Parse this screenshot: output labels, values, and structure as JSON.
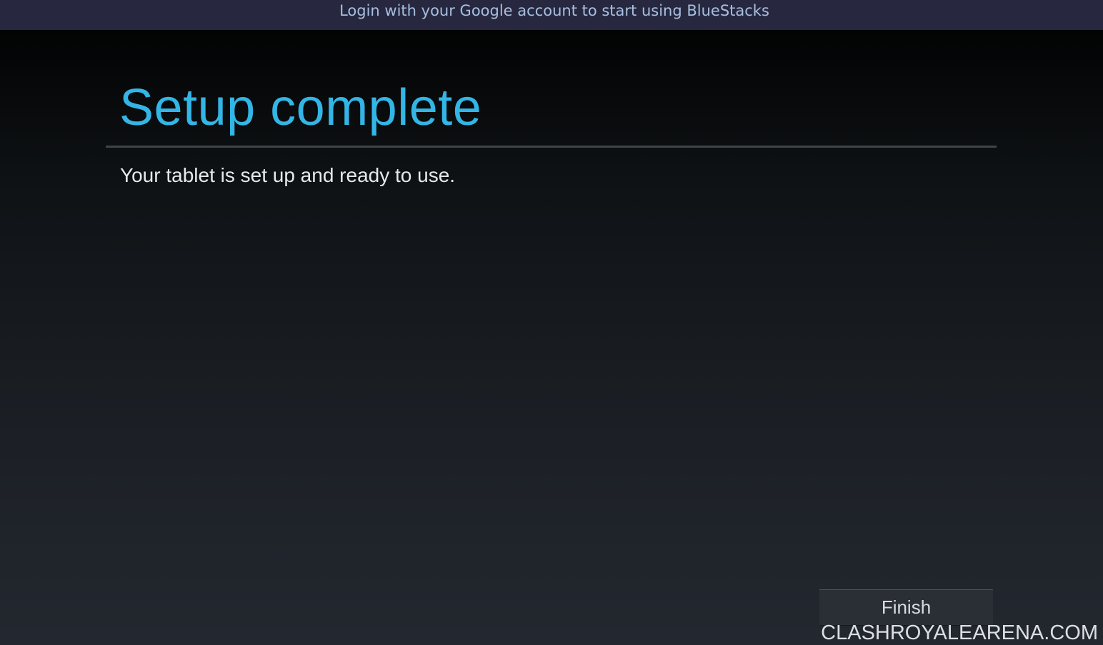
{
  "banner": {
    "text": "Login with your Google account to start using BlueStacks"
  },
  "setup": {
    "title": "Setup complete",
    "message": "Your tablet is set up and ready to use.",
    "finish_label": "Finish"
  },
  "watermark": {
    "text": "CLASHROYALEARENA.COM"
  },
  "colors": {
    "accent": "#33b5e5",
    "banner_background": "#27283f",
    "banner_text": "#a7bfe0"
  }
}
